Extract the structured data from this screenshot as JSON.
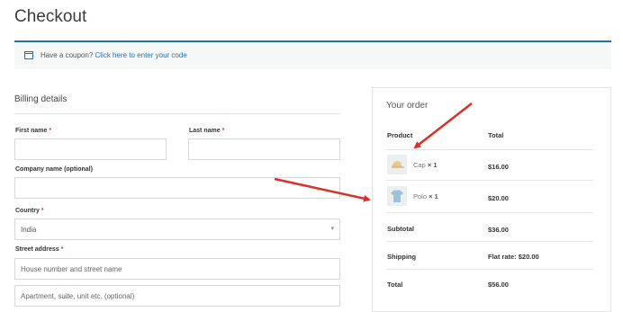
{
  "page": {
    "title": "Checkout"
  },
  "coupon": {
    "prompt": "Have a coupon?",
    "link": "Click here to enter your code"
  },
  "billing": {
    "heading": "Billing details",
    "first_name": {
      "label": "First name",
      "req": "*",
      "value": ""
    },
    "last_name": {
      "label": "Last name",
      "req": "*",
      "value": ""
    },
    "company": {
      "label": "Company name (optional)",
      "value": ""
    },
    "country": {
      "label": "Country",
      "req": "*",
      "value": "India"
    },
    "street": {
      "label": "Street address",
      "req": "*",
      "placeholder1": "House number and street name",
      "placeholder2": "Apartment, suite, unit etc. (optional)"
    }
  },
  "order": {
    "heading": "Your order",
    "col_product": "Product",
    "col_total": "Total",
    "items": [
      {
        "name": "Cap",
        "qty": "× 1",
        "total": "$16.00",
        "icon": "cap-thumbnail"
      },
      {
        "name": "Polo",
        "qty": "× 1",
        "total": "$20.00",
        "icon": "polo-shirt-thumbnail"
      }
    ],
    "subtotal_label": "Subtotal",
    "subtotal": "$36.00",
    "shipping_label": "Shipping",
    "shipping": "Flat rate: $20.00",
    "total_label": "Total",
    "total": "$56.00"
  },
  "colors": {
    "accent": "#2271b1",
    "arrow": "#d9302a",
    "required": "#dd3333"
  }
}
